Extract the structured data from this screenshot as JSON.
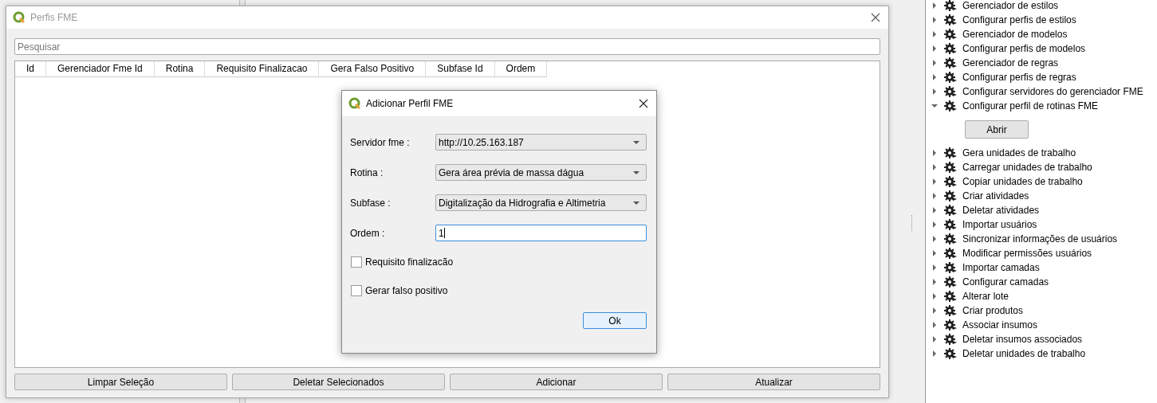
{
  "main_window": {
    "title": "Perfis FME",
    "search": {
      "placeholder": "Pesquisar"
    },
    "table": {
      "columns": [
        "Id",
        "Gerenciador Fme Id",
        "Rotina",
        "Requisito Finalizacao",
        "Gera Falso Positivo",
        "Subfase Id",
        "Ordem"
      ]
    },
    "buttons": [
      "Limpar Seleção",
      "Deletar Selecionados",
      "Adicionar",
      "Atualizar"
    ]
  },
  "dialog": {
    "title": "Adicionar Perfil FME",
    "fields": [
      {
        "kind": "combo",
        "label": "Servidor fme :",
        "value": "http://10.25.163.187"
      },
      {
        "kind": "combo",
        "label": "Rotina :",
        "value": "Gera área prévia de massa dágua"
      },
      {
        "kind": "combo",
        "label": "Subfase :",
        "value": "Digitalização da Hidrografia e Altimetria"
      },
      {
        "kind": "input",
        "label": "Ordem :",
        "value": "1",
        "focused": true
      }
    ],
    "checkboxes": [
      {
        "label": "Requisito finalizacão",
        "checked": false
      },
      {
        "label": "Gerar falso positivo",
        "checked": false
      }
    ],
    "ok_button": "Ok"
  },
  "tree": {
    "items": [
      {
        "label": "Gerenciador de estilos",
        "expanded": false
      },
      {
        "label": "Configurar perfis de estilos",
        "expanded": false
      },
      {
        "label": "Gerenciador de modelos",
        "expanded": false
      },
      {
        "label": "Configurar perfis de modelos",
        "expanded": false
      },
      {
        "label": "Gerenciador de regras",
        "expanded": false
      },
      {
        "label": "Configurar perfis de regras",
        "expanded": false
      },
      {
        "label": "Configurar servidores do gerenciador FME",
        "expanded": false
      },
      {
        "label": "Configurar perfil de rotinas FME",
        "expanded": true,
        "button": "Abrir"
      },
      {
        "label": "Gera unidades de trabalho",
        "expanded": false
      },
      {
        "label": "Carregar unidades de trabalho",
        "expanded": false
      },
      {
        "label": "Copiar unidades de trabalho",
        "expanded": false
      },
      {
        "label": "Criar atividades",
        "expanded": false
      },
      {
        "label": "Deletar atividades",
        "expanded": false
      },
      {
        "label": "Importar usuários",
        "expanded": false
      },
      {
        "label": "Sincronizar informações de usuários",
        "expanded": false
      },
      {
        "label": "Modificar permissões usuários",
        "expanded": false
      },
      {
        "label": "Importar camadas",
        "expanded": false
      },
      {
        "label": "Configurar camadas",
        "expanded": false
      },
      {
        "label": "Alterar lote",
        "expanded": false
      },
      {
        "label": "Criar produtos",
        "expanded": false
      },
      {
        "label": "Associar insumos",
        "expanded": false
      },
      {
        "label": "Deletar insumos associados",
        "expanded": false
      },
      {
        "label": "Deletar unidades de trabalho",
        "expanded": false
      }
    ]
  }
}
